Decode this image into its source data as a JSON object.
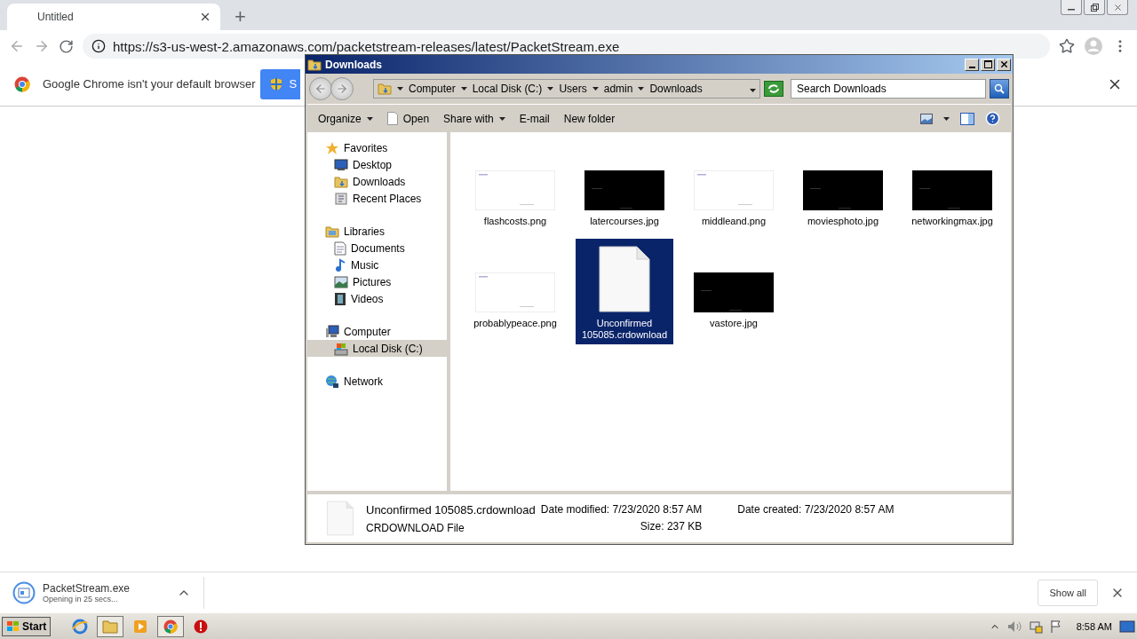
{
  "browser": {
    "tab": {
      "title": "Untitled",
      "selected": true
    },
    "new_tab": "+",
    "url": "https://s3-us-west-2.amazonaws.com/packetstream-releases/latest/PacketStream.exe",
    "infobar": {
      "message": "Google Chrome isn't your default browser",
      "button": "S"
    }
  },
  "explorer": {
    "title": "Downloads",
    "breadcrumb": [
      "Computer",
      "Local Disk (C:)",
      "Users",
      "admin",
      "Downloads"
    ],
    "search": {
      "placeholder": "Search Downloads"
    },
    "toolbar": [
      {
        "label": "Organize",
        "dropdown": true,
        "icon": false
      },
      {
        "label": "Open",
        "dropdown": false,
        "icon": true
      },
      {
        "label": "Share with",
        "dropdown": true,
        "icon": false
      },
      {
        "label": "E-mail",
        "dropdown": false,
        "icon": false
      },
      {
        "label": "New folder",
        "dropdown": false,
        "icon": false
      }
    ],
    "nav": [
      {
        "label": "Favorites",
        "selected": false,
        "children": [
          {
            "label": "Desktop",
            "selected": false
          },
          {
            "label": "Downloads",
            "selected": false
          },
          {
            "label": "Recent Places",
            "selected": false
          }
        ]
      },
      {
        "label": "Libraries",
        "selected": false,
        "children": [
          {
            "label": "Documents",
            "selected": false
          },
          {
            "label": "Music",
            "selected": false
          },
          {
            "label": "Pictures",
            "selected": false
          },
          {
            "label": "Videos",
            "selected": false
          }
        ]
      },
      {
        "label": "Computer",
        "selected": false,
        "children": [
          {
            "label": "Local Disk (C:)",
            "selected": true
          }
        ]
      },
      {
        "label": "Network",
        "selected": false
      }
    ],
    "files": [
      {
        "name": "flashcosts.png",
        "kind": "light",
        "selected": false
      },
      {
        "name": "latercourses.jpg",
        "kind": "dark",
        "selected": false
      },
      {
        "name": "middleand.png",
        "kind": "light",
        "selected": false
      },
      {
        "name": "moviesphoto.jpg",
        "kind": "dark",
        "selected": false
      },
      {
        "name": "networkingmax.jpg",
        "kind": "dark",
        "selected": false
      },
      {
        "name": "probablypeace.png",
        "kind": "light",
        "selected": false
      },
      {
        "name": "Unconfirmed 105085.crdownload",
        "kind": "document",
        "selected": true
      },
      {
        "name": "vastore.jpg",
        "kind": "dark",
        "selected": false
      }
    ],
    "details": {
      "name": "Unconfirmed 105085.crdownload",
      "type": "CRDOWNLOAD File",
      "fields": [
        {
          "label": "Date modified:",
          "value": "7/23/2020 8:57 AM"
        },
        {
          "label": "Date created:",
          "value": "7/23/2020 8:57 AM"
        },
        {
          "label": "Size:",
          "value": "237 KB"
        }
      ]
    }
  },
  "download": {
    "file": "PacketStream.exe",
    "status": "Opening in 25 secs...",
    "show_all": "Show all"
  },
  "taskbar": {
    "start": "Start",
    "apps": [
      {
        "selected": false
      },
      {
        "selected": true
      },
      {
        "selected": false
      },
      {
        "selected": true
      },
      {
        "selected": false
      }
    ],
    "clock": "8:58 AM"
  }
}
